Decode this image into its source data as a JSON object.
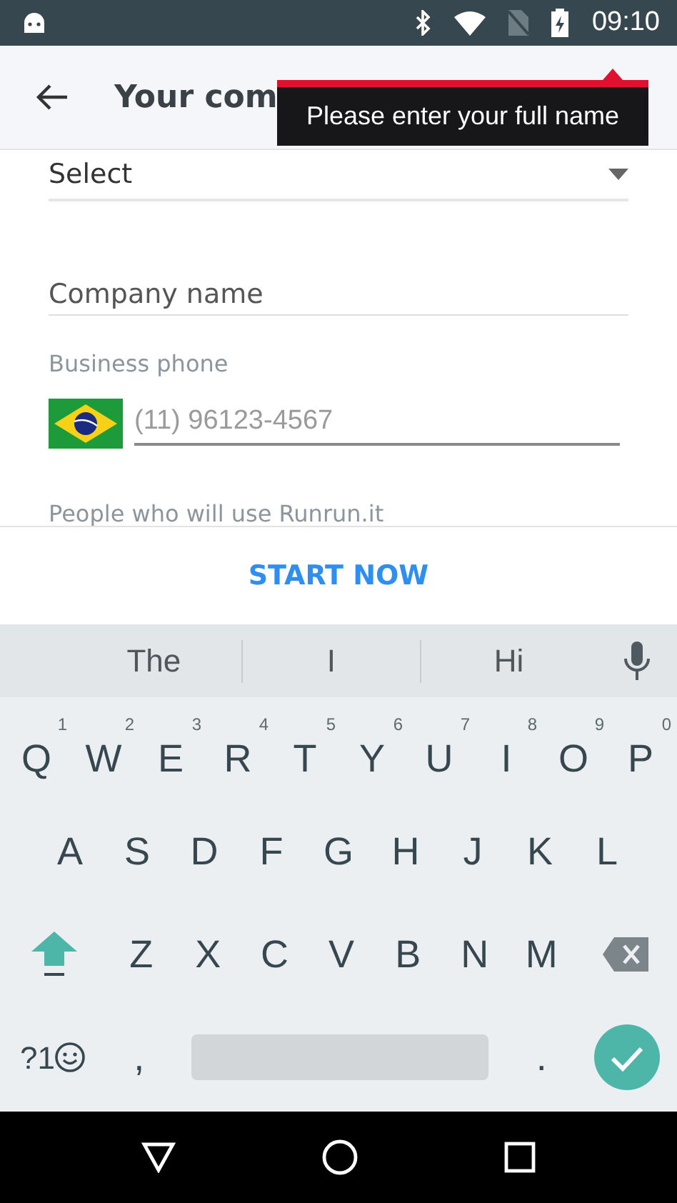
{
  "status_bar": {
    "time": "09:10"
  },
  "app_bar": {
    "title": "Your com"
  },
  "tooltip": {
    "text": "Please enter your full name"
  },
  "form": {
    "select": {
      "value": "Select"
    },
    "company_name": {
      "placeholder": "Company name"
    },
    "phone": {
      "label": "Business phone",
      "placeholder": "(11) 96123-4567"
    },
    "next_label": "People who will use Runrun.it"
  },
  "primary_button": "START NOW",
  "keyboard": {
    "suggestions": [
      "The",
      "I",
      "Hi"
    ],
    "rows": [
      [
        {
          "key": "Q",
          "hint": "1"
        },
        {
          "key": "W",
          "hint": "2"
        },
        {
          "key": "E",
          "hint": "3"
        },
        {
          "key": "R",
          "hint": "4"
        },
        {
          "key": "T",
          "hint": "5"
        },
        {
          "key": "Y",
          "hint": "6"
        },
        {
          "key": "U",
          "hint": "7"
        },
        {
          "key": "I",
          "hint": "8"
        },
        {
          "key": "O",
          "hint": "9"
        },
        {
          "key": "P",
          "hint": "0"
        }
      ],
      [
        {
          "key": "A"
        },
        {
          "key": "S"
        },
        {
          "key": "D"
        },
        {
          "key": "F"
        },
        {
          "key": "G"
        },
        {
          "key": "H"
        },
        {
          "key": "J"
        },
        {
          "key": "K"
        },
        {
          "key": "L"
        }
      ],
      [
        {
          "key": "Z"
        },
        {
          "key": "X"
        },
        {
          "key": "C"
        },
        {
          "key": "V"
        },
        {
          "key": "B"
        },
        {
          "key": "N"
        },
        {
          "key": "M"
        }
      ]
    ],
    "symbols_key": "?1",
    "comma_key": ",",
    "period_key": "."
  }
}
